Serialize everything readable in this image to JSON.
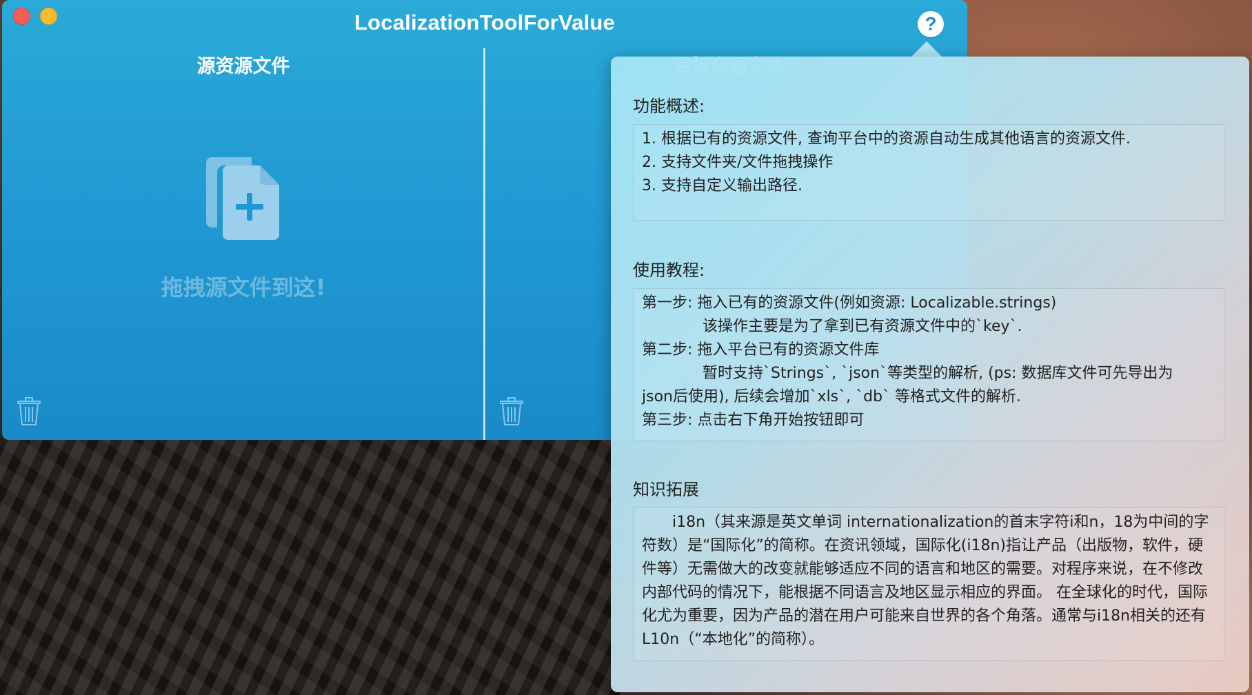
{
  "window": {
    "title": "LocalizationToolForValue",
    "help_label": "?"
  },
  "left_pane": {
    "title": "源资源文件",
    "drop_hint": "拖拽源文件到这!"
  },
  "right_pane": {
    "title": "目标资源文件"
  },
  "popover": {
    "overview": {
      "title": "功能概述:",
      "items": [
        "1. 根据已有的资源文件, 查询平台中的资源自动生成其他语言的资源文件.",
        "2. 支持文件夹/文件拖拽操作",
        "3. 支持自定义输出路径."
      ]
    },
    "tutorial": {
      "title": "使用教程:",
      "lines": [
        "第一步: 拖入已有的资源文件(例如资源: Localizable.strings)",
        "该操作主要是为了拿到已有资源文件中的`key`.",
        "第二步: 拖入平台已有的资源文件库",
        "暂时支持`Strings`, `json`等类型的解析, (ps: 数据库文件可先导出为",
        "json后使用), 后续会增加`xls`, `db` 等格式文件的解析.",
        "第三步: 点击右下角开始按钮即可"
      ]
    },
    "knowledge": {
      "title": "知识拓展",
      "text": "i18n（其来源是英文单词 internationalization的首末字符i和n，18为中间的字符数）是“国际化”的简称。在资讯领域，国际化(i18n)指让产品（出版物，软件，硬件等）无需做大的改变就能够适应不同的语言和地区的需要。对程序来说，在不修改内部代码的情况下，能根据不同语言及地区显示相应的界面。 在全球化的时代，国际化尤为重要，因为产品的潜在用户可能来自世界的各个角落。通常与i18n相关的还有L10n（“本地化”的简称）。"
    }
  },
  "colors": {
    "window_blue": "#1f97d2",
    "close": "#fc5b57",
    "minimize": "#fdbc2e"
  }
}
